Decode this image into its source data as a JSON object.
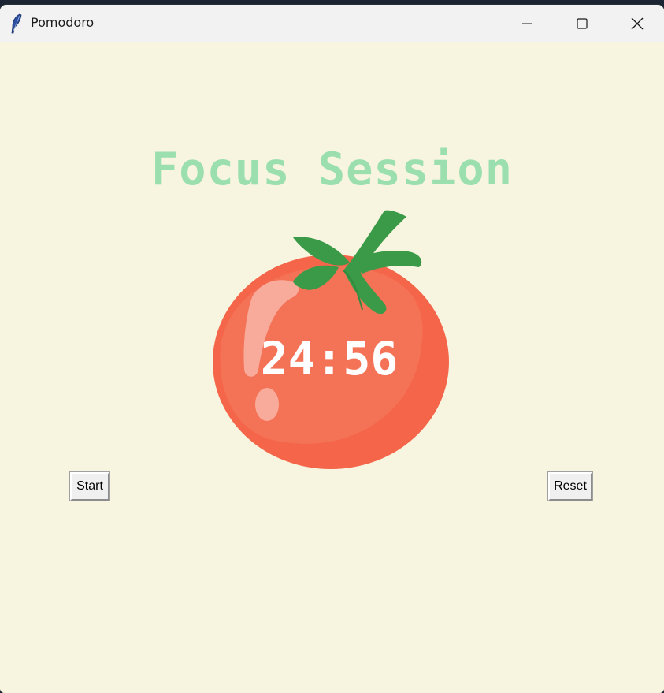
{
  "window": {
    "title": "Pomodoro",
    "icon": "feather-icon",
    "controls": {
      "minimize": "minimize-icon",
      "maximize": "maximize-icon",
      "close": "close-icon"
    }
  },
  "main": {
    "heading": "Focus Session",
    "timer": "24:56",
    "image": "tomato-icon",
    "start_label": "Start",
    "reset_label": "Reset"
  },
  "colors": {
    "background": "#f7f5df",
    "heading": "#9bdfae",
    "timer": "#ffffff",
    "tomato": "#f26b4b",
    "leaves": "#3a9a47"
  }
}
